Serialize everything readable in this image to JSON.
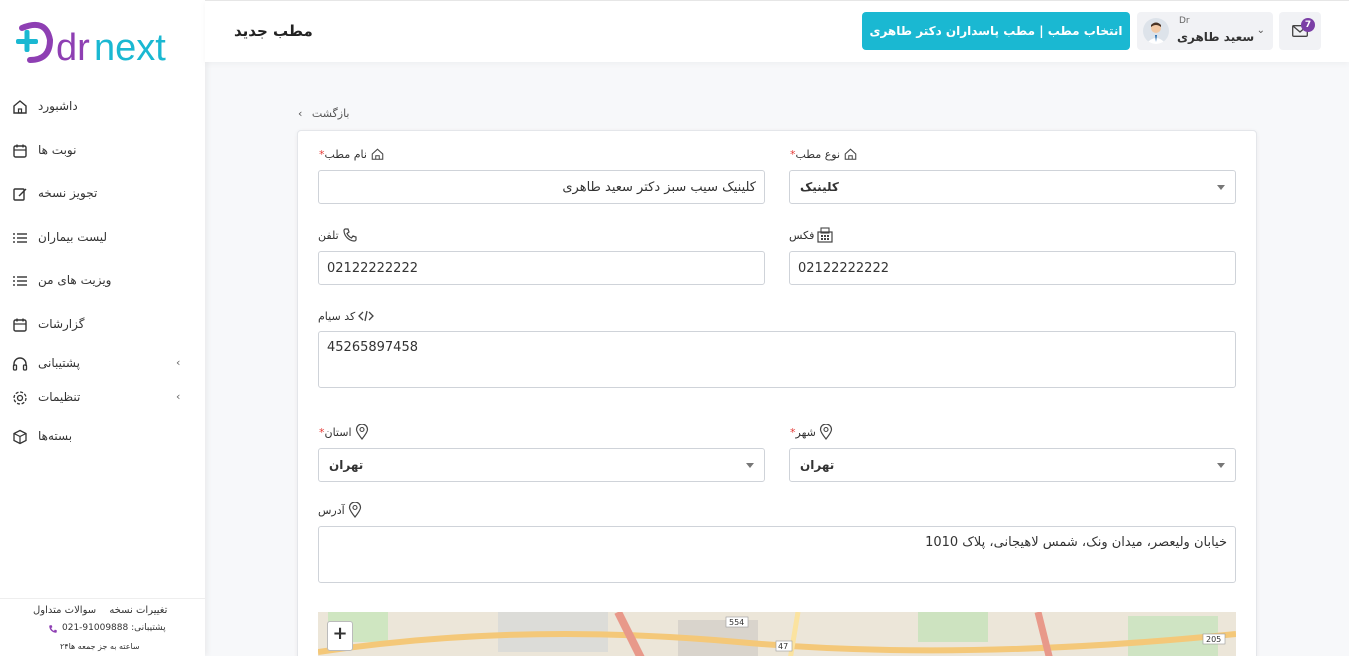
{
  "header": {
    "page_title": "مطب جدید",
    "clinic_button": "انتخاب مطب | مطب پاسداران دکتر طاهری",
    "user_prefix": "Dr",
    "user_name": "سعید طاهری",
    "messages_count": "7"
  },
  "sidebar": {
    "logo_text": "drnext",
    "items": [
      {
        "label": "داشبورد",
        "icon": "home-icon"
      },
      {
        "label": "نوبت ها",
        "icon": "calendar-icon"
      },
      {
        "label": "تجویز نسخه",
        "icon": "edit-icon"
      },
      {
        "label": "لیست بیماران",
        "icon": "list-icon"
      },
      {
        "label": "ویزیت های من",
        "icon": "list-icon"
      },
      {
        "label": "گزارشات",
        "icon": "calendar-icon"
      },
      {
        "label": "پشتیبانی",
        "icon": "headset-icon"
      },
      {
        "label": "تنظیمات",
        "icon": "gear-icon"
      },
      {
        "label": "بسته‌ها",
        "icon": "box-icon"
      }
    ],
    "footer": {
      "faq": "سوالات متداول",
      "changelog": "تغییرات نسخه",
      "support_phone": "021-91009888 :پشتیبانی",
      "hours": "۲۴ساعته به جز جمعه ها"
    }
  },
  "form": {
    "back_label": "بازگشت",
    "clinic_name_label": "نام مطب",
    "clinic_name_value": "کلینیک سیب سبز دکتر سعید طاهری",
    "clinic_type_label": "نوع مطب",
    "clinic_type_value": "کلینیک",
    "phone_label": "تلفن",
    "phone_value": "02122222222",
    "fax_label": "فکس",
    "fax_value": "02122222222",
    "sim_code_label": "کد سیام",
    "sim_code_value": "45265897458",
    "province_label": "استان",
    "province_value": "تهران",
    "city_label": "شهر",
    "city_value": "تهران",
    "address_label": "آدرس",
    "address_value": "خیابان ولیعصر، میدان ونک، شمس لاهیجانی، پلاک 1010",
    "required_mark": "*"
  },
  "map": {
    "zoom_in": "+",
    "labels": [
      "554",
      "47",
      "205"
    ]
  },
  "colors": {
    "accent": "#1ab8d2",
    "brand_purple": "#8e3fb3",
    "brand_cyan": "#1ab8d2",
    "badge": "#7b3fa6",
    "required": "#e53935"
  }
}
